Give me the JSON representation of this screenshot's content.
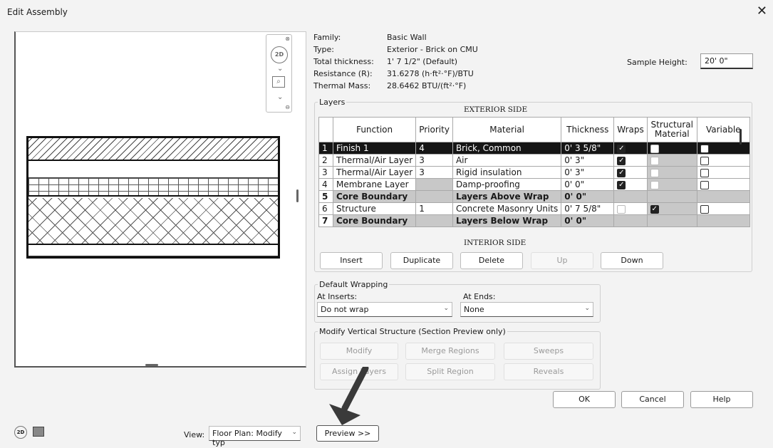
{
  "window": {
    "title": "Edit Assembly",
    "close": "✕"
  },
  "properties": [
    {
      "label": "Family:",
      "value": "Basic Wall"
    },
    {
      "label": "Type:",
      "value": "Exterior - Brick on CMU"
    },
    {
      "label": "Total thickness:",
      "value": "1'  7 1/2\" (Default)"
    },
    {
      "label": "Resistance (R):",
      "value": "31.6278 (h·ft²·°F)/BTU"
    },
    {
      "label": "Thermal Mass:",
      "value": "28.6462 BTU/(ft²·°F)"
    }
  ],
  "sample_height": {
    "label": "Sample Height:",
    "value": "20'  0\""
  },
  "layers": {
    "group_label": "Layers",
    "exterior_label": "EXTERIOR SIDE",
    "interior_label": "INTERIOR SIDE",
    "columns": [
      "",
      "Function",
      "Priority",
      "Material",
      "Thickness",
      "Wraps",
      "Structural Material",
      "Variable"
    ],
    "rows": [
      {
        "num": "1",
        "function": "Finish 1",
        "priority": "4",
        "material": "Brick, Common",
        "thickness": "0'  3 5/8\"",
        "wraps": true,
        "structural": false,
        "variable": false,
        "selected": true,
        "core": false
      },
      {
        "num": "2",
        "function": "Thermal/Air Layer",
        "priority": "3",
        "material": "Air",
        "thickness": "0'  3\"",
        "wraps": true,
        "structural": false,
        "variable": false,
        "selected": false,
        "core": false
      },
      {
        "num": "3",
        "function": "Thermal/Air Layer",
        "priority": "3",
        "material": "Rigid insulation",
        "thickness": "0'  3\"",
        "wraps": true,
        "structural": false,
        "variable": false,
        "selected": false,
        "core": false
      },
      {
        "num": "4",
        "function": "Membrane Layer",
        "priority": "",
        "material": "Damp-proofing",
        "thickness": "0'  0\"",
        "wraps": true,
        "structural": false,
        "variable": false,
        "selected": false,
        "core": false
      },
      {
        "num": "5",
        "function": "Core Boundary",
        "priority": "",
        "material": "Layers Above Wrap",
        "thickness": "0'  0\"",
        "wraps": null,
        "structural": null,
        "variable": null,
        "selected": false,
        "core": true
      },
      {
        "num": "6",
        "function": "Structure",
        "priority": "1",
        "material": "Concrete Masonry Units",
        "thickness": "0'  7 5/8\"",
        "wraps": false,
        "structural": true,
        "variable": false,
        "selected": false,
        "core": false
      },
      {
        "num": "7",
        "function": "Core Boundary",
        "priority": "",
        "material": "Layers Below Wrap",
        "thickness": "0'  0\"",
        "wraps": null,
        "structural": null,
        "variable": null,
        "selected": false,
        "core": true
      }
    ],
    "buttons": {
      "insert": "Insert",
      "duplicate": "Duplicate",
      "delete": "Delete",
      "up": "Up",
      "down": "Down"
    }
  },
  "default_wrapping": {
    "group_label": "Default Wrapping",
    "at_inserts_label": "At Inserts:",
    "at_inserts_value": "Do not wrap",
    "at_ends_label": "At Ends:",
    "at_ends_value": "None"
  },
  "modify_vertical": {
    "group_label": "Modify Vertical Structure (Section Preview only)",
    "buttons": {
      "modify": "Modify",
      "merge": "Merge Regions",
      "sweeps": "Sweeps",
      "assign": "Assign Layers",
      "split": "Split Region",
      "reveals": "Reveals"
    }
  },
  "dialog_buttons": {
    "ok": "OK",
    "cancel": "Cancel",
    "help": "Help",
    "preview": "Preview >>"
  },
  "view": {
    "label": "View:",
    "value": "Floor Plan: Modify typ"
  },
  "icons": {
    "nav_2d": "2D",
    "zoom": "⌕",
    "chevron": "⌄"
  }
}
